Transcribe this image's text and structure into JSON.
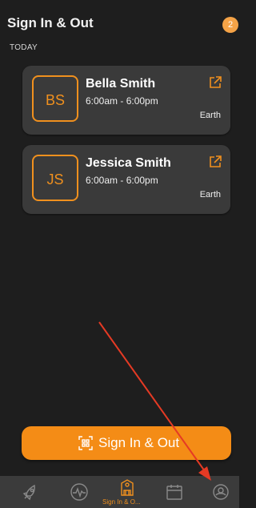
{
  "header": {
    "title": "Sign In & Out",
    "badge_count": "2"
  },
  "section": {
    "label": "TODAY"
  },
  "people": [
    {
      "initials": "BS",
      "name": "Bella Smith",
      "time": "6:00am - 6:00pm",
      "location": "Earth"
    },
    {
      "initials": "JS",
      "name": "Jessica Smith",
      "time": "6:00am - 6:00pm",
      "location": "Earth"
    }
  ],
  "actions": {
    "signin_label": "Sign In & Out"
  },
  "tabbar": {
    "items": [
      {
        "icon": "rocket-icon"
      },
      {
        "icon": "activity-icon"
      },
      {
        "icon": "sign-in-out-icon",
        "label": "Sign In & O...",
        "active": true
      },
      {
        "icon": "calendar-icon"
      },
      {
        "icon": "profile-icon"
      }
    ]
  },
  "colors": {
    "accent": "#f0901e",
    "background": "#1e1e1e",
    "card": "#3a3a3a",
    "annotation_arrow": "#e53a24"
  }
}
